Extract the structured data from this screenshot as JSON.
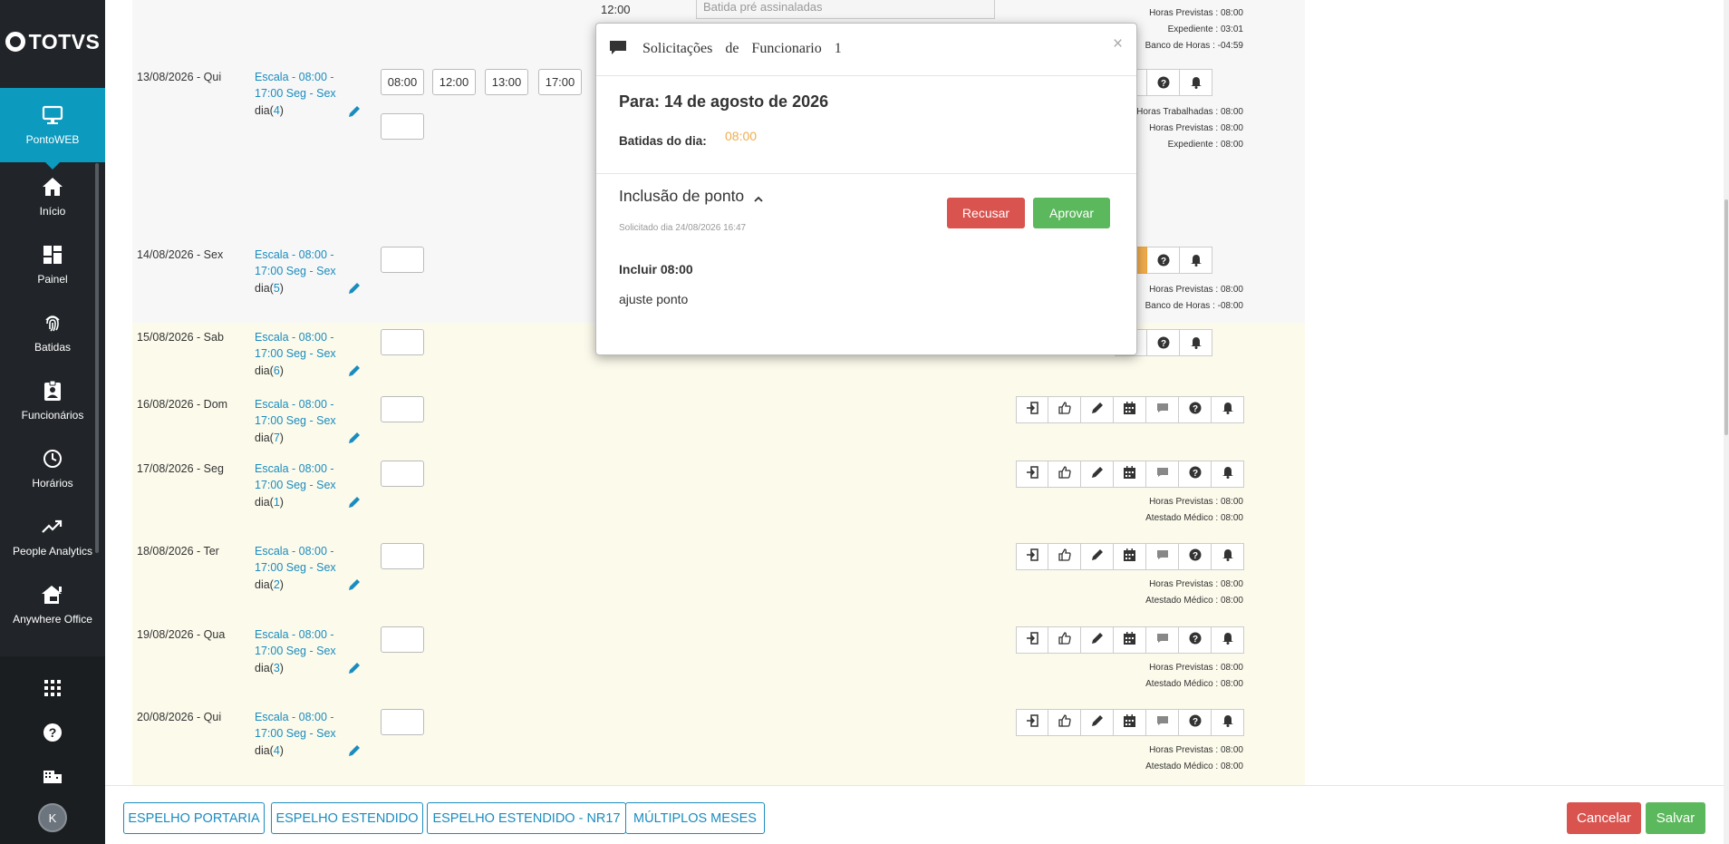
{
  "sidebar": {
    "logo": "TOTVS",
    "items": [
      {
        "label": "PontoWEB",
        "icon": "monitor-icon"
      },
      {
        "label": "Início",
        "icon": "home-icon"
      },
      {
        "label": "Painel",
        "icon": "dashboard-icon"
      },
      {
        "label": "Batidas",
        "icon": "fingerprint-icon"
      },
      {
        "label": "Funcionários",
        "icon": "badge-icon"
      },
      {
        "label": "Horários",
        "icon": "clock-icon"
      },
      {
        "label": "People Analytics",
        "icon": "trending-up-icon"
      },
      {
        "label": "Anywhere Office",
        "icon": "home-office-icon"
      }
    ],
    "bottom_icons": [
      "apps-grid-icon",
      "help-icon",
      "building-icon"
    ],
    "avatar_initial": "K"
  },
  "top_partial": {
    "time": "12:00",
    "placeholder": "Batida pré assinaladas",
    "summary": [
      "Horas Previstas : 08:00",
      "Expediente : 03:01",
      "Banco de Horas : -04:59"
    ]
  },
  "rows": [
    {
      "date": "13/08/2026 - Qui",
      "escala": "Escala - 08:00 - 17:00 Seg - Sex",
      "dia_prefix": "dia(",
      "dia_num": "4",
      "dia_suffix": ")",
      "times": [
        "08:00",
        "12:00",
        "13:00",
        "17:00"
      ],
      "summary": [
        "Horas Trabalhadas : 08:00",
        "Horas Previstas : 08:00",
        "Expediente : 08:00"
      ]
    },
    {
      "date": "14/08/2026 - Sex",
      "escala": "Escala - 08:00 - 17:00 Seg - Sex",
      "dia_prefix": "dia(",
      "dia_num": "5",
      "dia_suffix": ")",
      "times": [],
      "summary": [
        "Horas Previstas : 08:00",
        "Banco de Horas : -08:00"
      ]
    },
    {
      "date": "15/08/2026 - Sab",
      "escala": "Escala - 08:00 - 17:00 Seg - Sex",
      "dia_prefix": "dia(",
      "dia_num": "6",
      "dia_suffix": ")",
      "times": [],
      "summary": []
    },
    {
      "date": "16/08/2026 - Dom",
      "escala": "Escala - 08:00 - 17:00 Seg - Sex",
      "dia_prefix": "dia(",
      "dia_num": "7",
      "dia_suffix": ")",
      "times": [],
      "summary": []
    },
    {
      "date": "17/08/2026 - Seg",
      "escala": "Escala - 08:00 - 17:00 Seg - Sex",
      "dia_prefix": "dia(",
      "dia_num": "1",
      "dia_suffix": ")",
      "times": [],
      "summary": [
        "Horas Previstas : 08:00",
        "Atestado Médico : 08:00"
      ]
    },
    {
      "date": "18/08/2026 - Ter",
      "escala": "Escala - 08:00 - 17:00 Seg - Sex",
      "dia_prefix": "dia(",
      "dia_num": "2",
      "dia_suffix": ")",
      "times": [],
      "summary": [
        "Horas Previstas : 08:00",
        "Atestado Médico : 08:00"
      ]
    },
    {
      "date": "19/08/2026 - Qua",
      "escala": "Escala - 08:00 - 17:00 Seg - Sex",
      "dia_prefix": "dia(",
      "dia_num": "3",
      "dia_suffix": ")",
      "times": [],
      "summary": [
        "Horas Previstas : 08:00",
        "Atestado Médico : 08:00"
      ]
    },
    {
      "date": "20/08/2026 - Qui",
      "escala": "Escala - 08:00 - 17:00 Seg - Sex",
      "dia_prefix": "dia(",
      "dia_num": "4",
      "dia_suffix": ")",
      "times": [],
      "summary": [
        "Horas Previstas : 08:00",
        "Atestado Médico : 08:00"
      ]
    }
  ],
  "row_actions": [
    "exit-icon",
    "thumbs-up-icon",
    "pencil-icon",
    "calendar-icon",
    "comment-icon",
    "question-icon",
    "bell-icon"
  ],
  "footer": {
    "buttons": [
      "ESPELHO PORTARIA",
      "ESPELHO ESTENDIDO",
      "ESPELHO ESTENDIDO - NR17",
      "MÚLTIPLOS MESES"
    ],
    "cancel": "Cancelar",
    "save": "Salvar"
  },
  "modal": {
    "title": "Solicitações de Funcionario 1",
    "close": "×",
    "para": "Para: 14 de agosto de 2026",
    "batidas_label": "Batidas do dia:",
    "batidas_value": "08:00",
    "section": "Inclusão de ponto",
    "solicitado": "Solicitado dia 24/08/2026 16:47",
    "recusar": "Recusar",
    "aprovar": "Aprovar",
    "incluir": "Incluir 08:00",
    "observacao": "ajuste ponto"
  },
  "colors": {
    "accent": "#0c9abe",
    "link": "#1a8cbf",
    "danger": "#d9534f",
    "success": "#5cb85c",
    "warning": "#f0ad4e",
    "sidebar": "#212529"
  }
}
